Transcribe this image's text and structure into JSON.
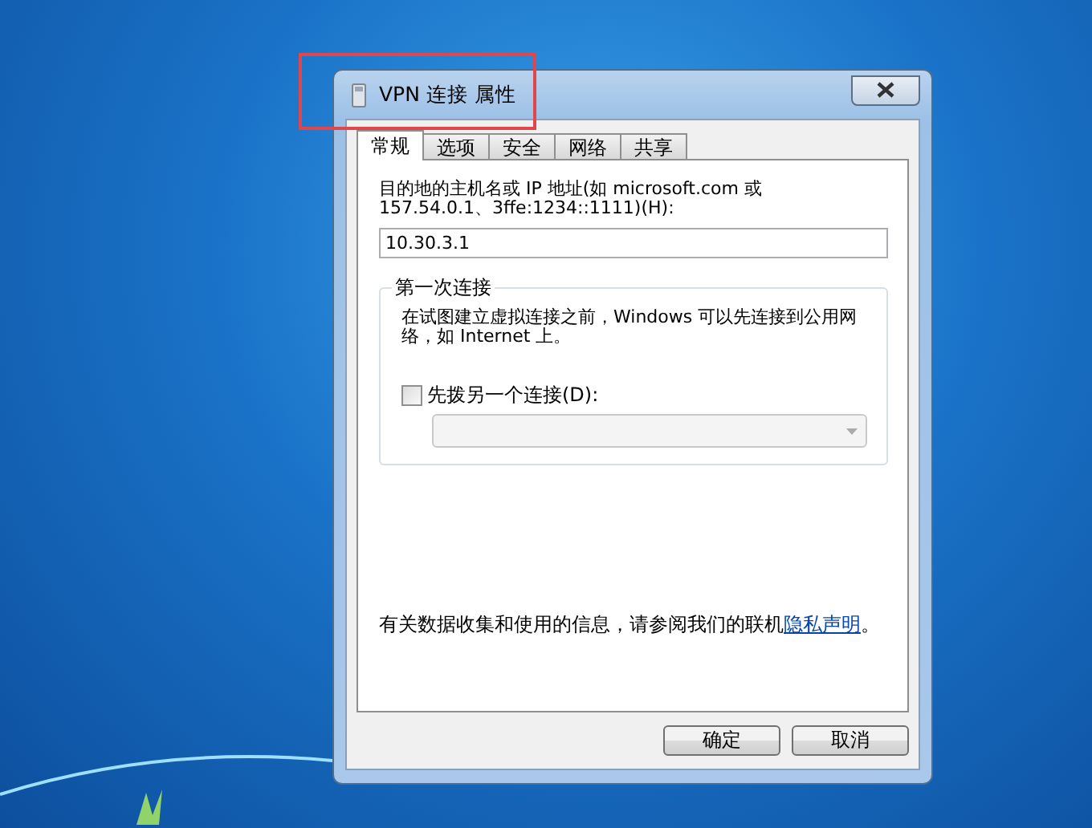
{
  "window": {
    "title": "VPN 连接 属性"
  },
  "tabs": [
    {
      "label": "常规",
      "selected": true
    },
    {
      "label": "选项",
      "selected": false
    },
    {
      "label": "安全",
      "selected": false
    },
    {
      "label": "网络",
      "selected": false
    },
    {
      "label": "共享",
      "selected": false
    }
  ],
  "host": {
    "label": "目的地的主机名或 IP 地址(如 microsoft.com 或 157.54.0.1、3ffe:1234::1111)(H):",
    "value": "10.30.3.1"
  },
  "first_connection": {
    "title": "第一次连接",
    "description": "在试图建立虚拟连接之前，Windows 可以先连接到公用网络，如 Internet 上。",
    "checkbox": {
      "label": "先拨另一个连接(D):",
      "checked": false
    },
    "dropdown": {
      "disabled": true
    }
  },
  "privacy": {
    "before": "有关数据收集和使用的信息，请参阅我们的联机",
    "link": "隐私声明",
    "after": "。"
  },
  "buttons": [
    {
      "label": "确定"
    },
    {
      "label": "取消"
    }
  ]
}
